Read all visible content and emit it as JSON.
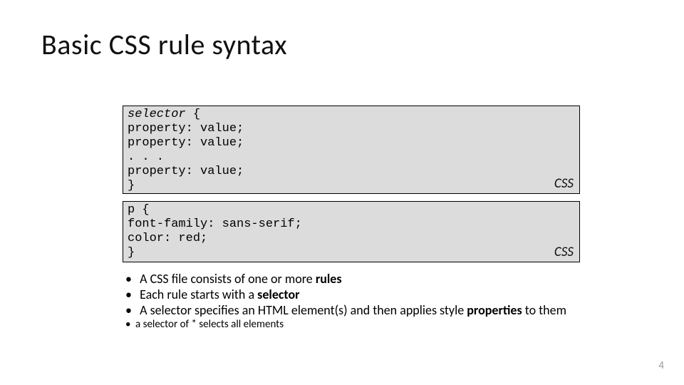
{
  "title": "Basic CSS rule syntax",
  "codebox1": {
    "line1_ital": "selector",
    "line1_rest": " {",
    "line2": "property: value;",
    "line3": "property: value;",
    "line4": ". . .",
    "line5": "property: value;",
    "line6": "}",
    "label": "CSS"
  },
  "codebox2": {
    "line1": "p {",
    "line2": "font-family: sans-serif;",
    "line3": "color: red;",
    "line4": "}",
    "label": "CSS"
  },
  "bullets": {
    "b1_pre": "A CSS file consists of one or more ",
    "b1_bold": "rules",
    "b2_pre": "Each rule starts with a ",
    "b2_bold": "selector",
    "b3_pre": "A selector specifies an HTML element(s) and then applies style ",
    "b3_bold": "properties",
    "b3_post": " to them",
    "sub1": "a selector of * selects all elements"
  },
  "page_number": "4"
}
